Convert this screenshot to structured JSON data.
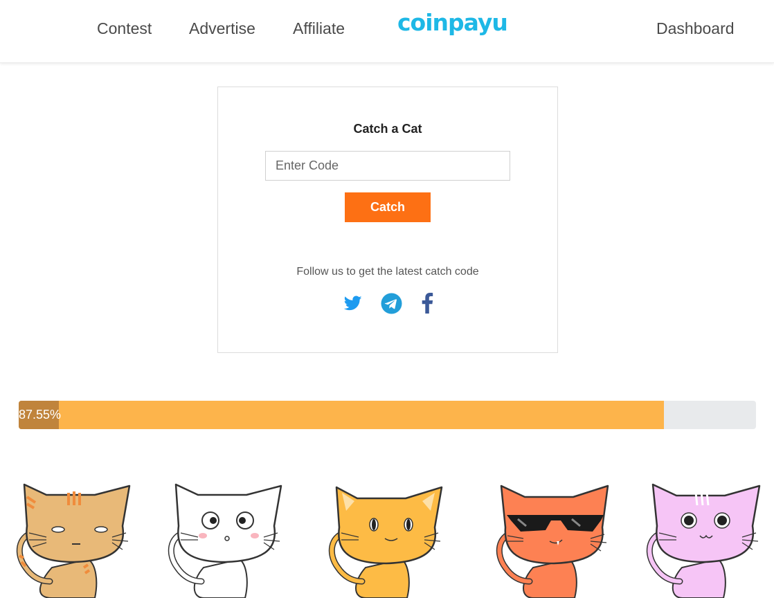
{
  "nav": {
    "links": [
      "Contest",
      "Advertise",
      "Affiliate"
    ],
    "logo_text": "coinpayu",
    "dashboard": "Dashboard"
  },
  "card": {
    "title": "Catch a Cat",
    "input_placeholder": "Enter Code",
    "input_value": "",
    "button_label": "Catch",
    "follow_text": "Follow us to get the latest catch code",
    "social_icons": [
      "twitter-icon",
      "telegram-icon",
      "facebook-icon"
    ]
  },
  "progress": {
    "value_percent": 87.55,
    "label": "87.55%"
  },
  "cats": [
    "orange-tabby-cat",
    "white-cat",
    "yellow-cat",
    "sunglasses-cat",
    "pink-cat"
  ],
  "colors": {
    "brand": "#1eb8e6",
    "button": "#fd7014",
    "progress_fill": "#fdb44b",
    "progress_label_bg": "#c0843c",
    "progress_track": "#e8eaec",
    "twitter": "#1d9bf0",
    "telegram": "#229ed9",
    "facebook": "#3b5998"
  }
}
